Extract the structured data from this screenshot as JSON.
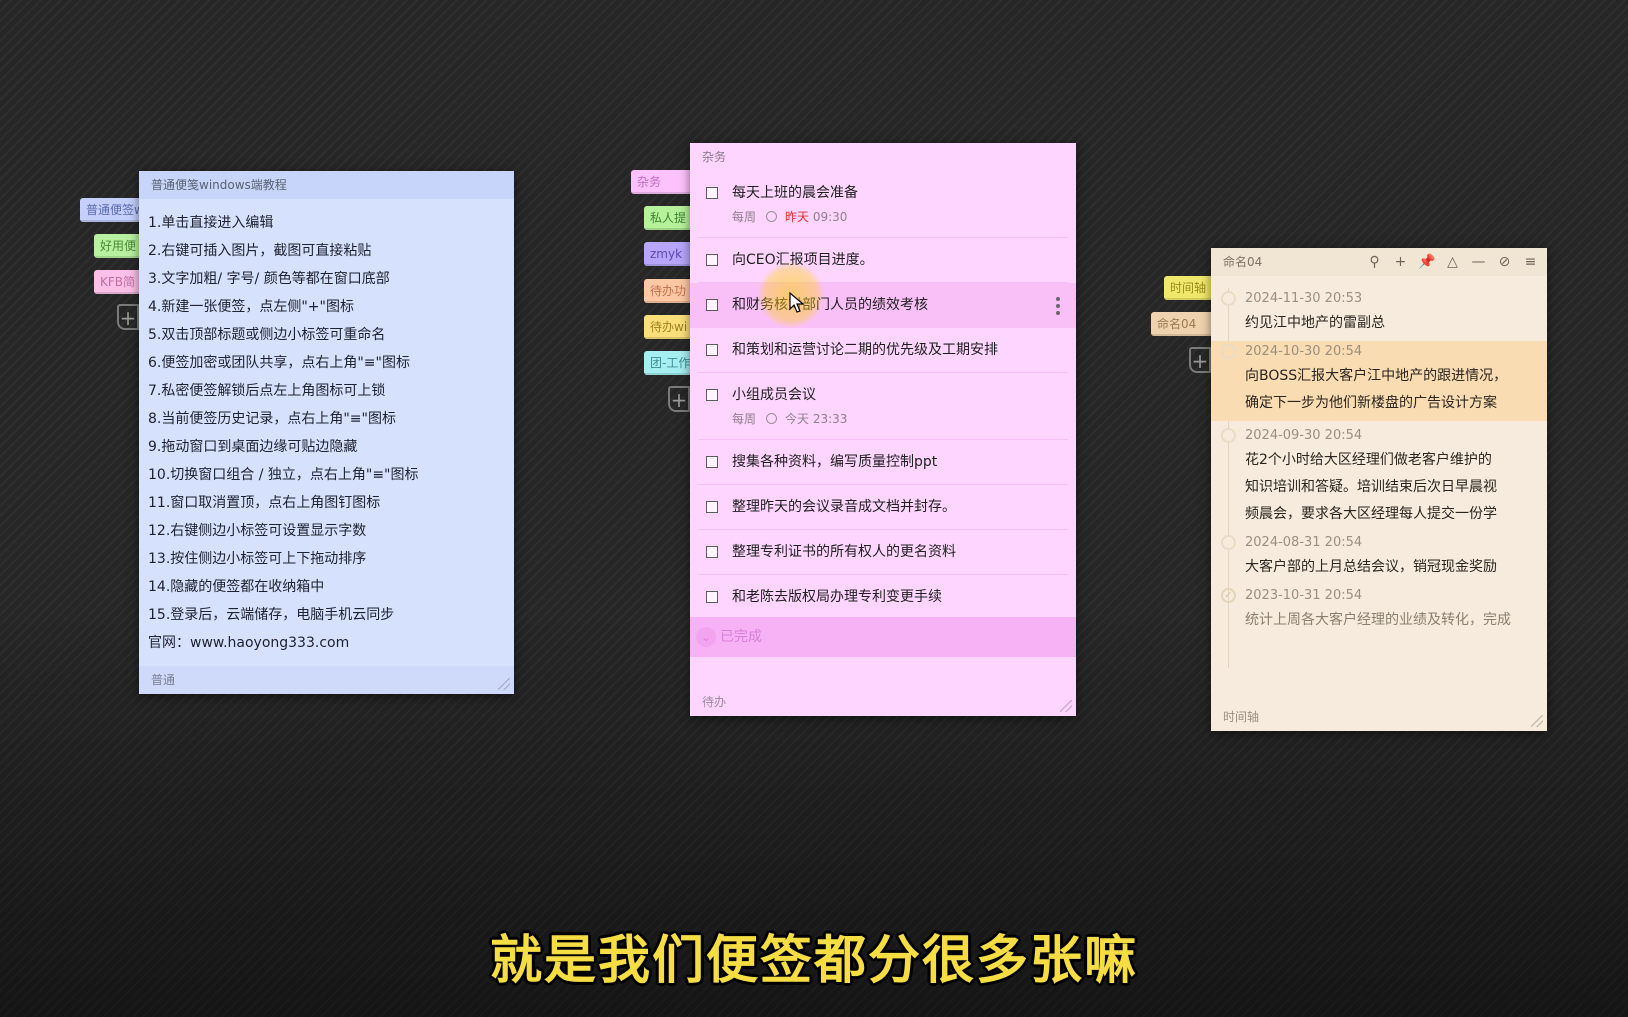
{
  "note1": {
    "title": "普通便笺windows端教程",
    "lines": [
      "1.单击直接进入编辑",
      "2.右键可插入图片，截图可直接粘贴",
      "3.文字加粗/ 字号/ 颜色等都在窗口底部",
      "4.新建一张便签，点左侧\"+\"图标",
      "5.双击顶部标题或侧边小标签可重命名",
      "6.便签加密或团队共享，点右上角\"≡\"图标",
      "7.私密便签解锁后点左上角图标可上锁",
      "8.当前便签历史记录，点右上角\"≡\"图标",
      "9.拖动窗口到桌面边缘可贴边隐藏",
      "10.切换窗口组合 / 独立，点右上角\"≡\"图标",
      "11.窗口取消置顶，点右上角图钉图标",
      "12.右键侧边小标签可设置显示字数",
      "13.按住侧边小标签可上下拖动排序",
      "14.隐藏的便签都在收纳箱中",
      "15.登录后，云端储存，电脑手机云同步",
      "官网：www.haoyong333.com"
    ],
    "footer": "普通",
    "tabs": [
      {
        "label": "普通便签w",
        "color": "#c4d0fb",
        "text": "#5a6ab0"
      },
      {
        "label": "好用便",
        "color": "#b8f2a0",
        "text": "#4a8a3a"
      },
      {
        "label": "KFB简",
        "color": "#fbc0e8",
        "text": "#c070a0"
      }
    ]
  },
  "note2": {
    "title": "杂务",
    "items": [
      {
        "text": "每天上班的晨会准备",
        "repeat": "每周",
        "when": "昨天",
        "time": "09:30"
      },
      {
        "text": "向CEO汇报项目进度。"
      },
      {
        "text": "和财务核对部门人员的绩效考核"
      },
      {
        "text": "和策划和运营讨论二期的优先级及工期安排"
      },
      {
        "text": "小组成员会议",
        "repeat": "每周",
        "when": "今天",
        "time": "23:33"
      },
      {
        "text": "搜集各种资料，编写质量控制ppt"
      },
      {
        "text": "整理昨天的会议录音成文档并封存。"
      },
      {
        "text": "整理专利证书的所有权人的更名资料"
      },
      {
        "text": "和老陈去版权局办理专利变更手续"
      }
    ],
    "done_label": "已完成",
    "footer": "待办",
    "tabs": [
      {
        "label": "杂务",
        "color": "#fdc2fb",
        "text": "#c070c0"
      },
      {
        "label": "私人提",
        "color": "#b6f29a",
        "text": "#3f8030"
      },
      {
        "label": "zmyk",
        "color": "#b7a6fb",
        "text": "#5a4ab0"
      },
      {
        "label": "待办功",
        "color": "#ffc8a4",
        "text": "#c07050"
      },
      {
        "label": "待办wi",
        "color": "#fbe07a",
        "text": "#a08020"
      },
      {
        "label": "团-工作",
        "color": "#a7eef0",
        "text": "#3a9096"
      }
    ]
  },
  "note3": {
    "title": "命名04",
    "icons": [
      "search-icon",
      "plus-icon",
      "pin-icon",
      "shirt-icon",
      "minimize-icon",
      "eye-hidden-icon",
      "menu-icon"
    ],
    "entries": [
      {
        "date": "2024-11-30 20:53",
        "lines": [
          "约见江中地产的雷副总"
        ]
      },
      {
        "date": "2024-10-30 20:54",
        "lines": [
          "向BOSS汇报大客户江中地产的跟进情况，",
          "确定下一步为他们新楼盘的广告设计方案"
        ]
      },
      {
        "date": "2024-09-30 20:54",
        "lines": [
          "花2个小时给大区经理们做老客户维护的",
          "知识培训和答疑。培训结束后次日早晨视",
          "频晨会，要求各大区经理每人提交一份学"
        ]
      },
      {
        "date": "2024-08-31 20:54",
        "lines": [
          "大客户部的上月总结会议，销冠现金奖励"
        ]
      },
      {
        "date": "2023-10-31 20:54",
        "lines": [
          "统计上周各大客户经理的业绩及转化，完成"
        ]
      }
    ],
    "footer": "时间轴",
    "tabs": [
      {
        "label": "时间轴",
        "color": "#f0e86a",
        "text": "#9a8a20"
      },
      {
        "label": "命名04",
        "color": "#efd3b0",
        "text": "#9a7a50"
      }
    ]
  },
  "caption": "就是我们便签都分很多张嘛"
}
